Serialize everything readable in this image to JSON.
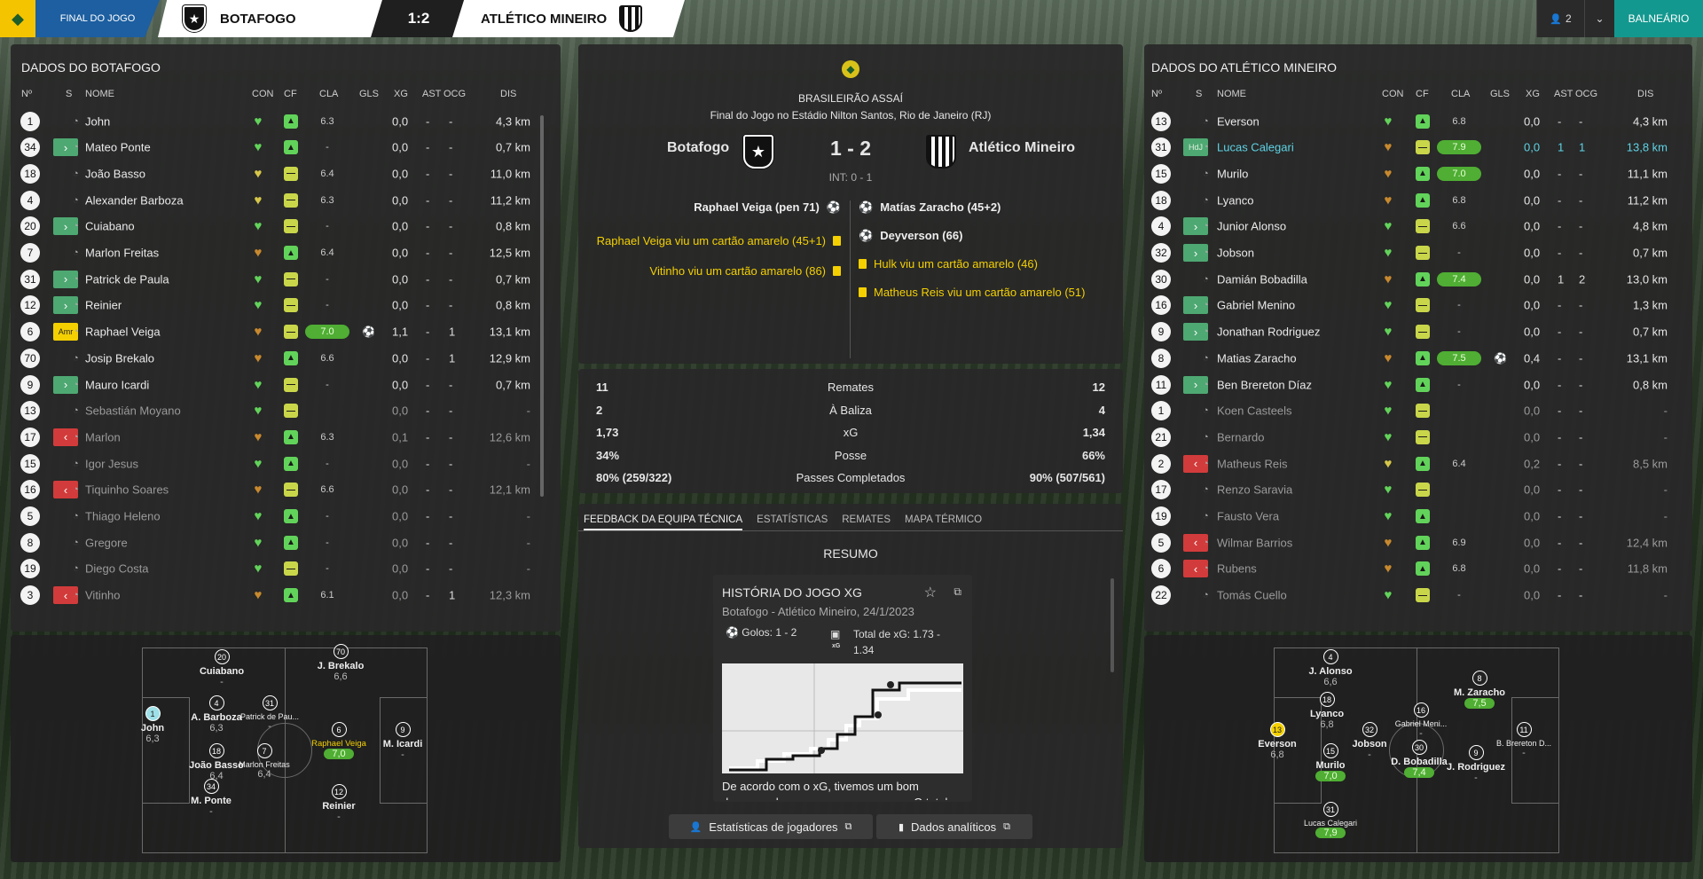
{
  "topbar": {
    "stage": "FINAL DO JOGO",
    "home": "BOTAFOGO",
    "score": "1:2",
    "away": "ATLÉTICO MINEIRO",
    "user_count": "2",
    "balneario": "BALNEÁRIO"
  },
  "home_panel": {
    "title": "DADOS DO BOTAFOGO"
  },
  "away_panel": {
    "title": "DADOS DO ATLÉTICO MINEIRO"
  },
  "columns": {
    "n": "Nº",
    "s": "S",
    "nome": "NOME",
    "con": "CON",
    "cf": "CF",
    "cla": "CLA",
    "gls": "GLS",
    "xg": "XG",
    "ast": "AST",
    "ocg": "OCG",
    "dis": "DIS"
  },
  "home_players": [
    {
      "n": "1",
      "s": "",
      "name": "John",
      "cf": "g",
      "heart": "g",
      "cla": "6.3",
      "hl": false,
      "gl": "",
      "xg": "0,0",
      "ast": "-",
      "ocg": "-",
      "dis": "4,3 km",
      "dim": false
    },
    {
      "n": "34",
      "s": "in",
      "name": "Mateo Ponte",
      "cf": "g",
      "heart": "g",
      "cla": "-",
      "hl": false,
      "gl": "",
      "xg": "0,0",
      "ast": "-",
      "ocg": "-",
      "dis": "0,7 km",
      "dim": false
    },
    {
      "n": "18",
      "s": "",
      "name": "João Basso",
      "cf": "y",
      "heart": "y",
      "cla": "6.4",
      "hl": false,
      "gl": "",
      "xg": "0,0",
      "ast": "-",
      "ocg": "-",
      "dis": "11,0 km",
      "dim": false
    },
    {
      "n": "4",
      "s": "",
      "name": "Alexander Barboza",
      "cf": "y",
      "heart": "y",
      "cla": "6.3",
      "hl": false,
      "gl": "",
      "xg": "0,0",
      "ast": "-",
      "ocg": "-",
      "dis": "11,2 km",
      "dim": false
    },
    {
      "n": "20",
      "s": "in",
      "name": "Cuiabano",
      "cf": "y",
      "heart": "g",
      "cla": "-",
      "hl": false,
      "gl": "",
      "xg": "0,0",
      "ast": "-",
      "ocg": "-",
      "dis": "0,8 km",
      "dim": false
    },
    {
      "n": "7",
      "s": "",
      "name": "Marlon Freitas",
      "cf": "g",
      "heart": "o",
      "cla": "6.4",
      "hl": false,
      "gl": "",
      "xg": "0,0",
      "ast": "-",
      "ocg": "-",
      "dis": "12,5 km",
      "dim": false
    },
    {
      "n": "31",
      "s": "in",
      "name": "Patrick de Paula",
      "cf": "y",
      "heart": "g",
      "cla": "-",
      "hl": false,
      "gl": "",
      "xg": "0,0",
      "ast": "-",
      "ocg": "-",
      "dis": "0,7 km",
      "dim": false
    },
    {
      "n": "12",
      "s": "in",
      "name": "Reinier",
      "cf": "y",
      "heart": "g",
      "cla": "-",
      "hl": false,
      "gl": "",
      "xg": "0,0",
      "ast": "-",
      "ocg": "-",
      "dis": "0,8 km",
      "dim": false
    },
    {
      "n": "6",
      "s": "amr",
      "name": "Raphael Veiga",
      "cf": "y",
      "heart": "o",
      "cla": "7.0",
      "hl": true,
      "gl": "⚽",
      "xg": "1,1",
      "ast": "-",
      "ocg": "1",
      "dis": "13,1 km",
      "dim": false
    },
    {
      "n": "70",
      "s": "",
      "name": "Josip Brekalo",
      "cf": "g",
      "heart": "o",
      "cla": "6.6",
      "hl": false,
      "gl": "",
      "xg": "0,0",
      "ast": "-",
      "ocg": "1",
      "dis": "12,9 km",
      "dim": false
    },
    {
      "n": "9",
      "s": "in",
      "name": "Mauro Icardi",
      "cf": "y",
      "heart": "g",
      "cla": "-",
      "hl": false,
      "gl": "",
      "xg": "0,0",
      "ast": "-",
      "ocg": "-",
      "dis": "0,7 km",
      "dim": false
    },
    {
      "n": "13",
      "s": "",
      "name": "Sebastián Moyano",
      "cf": "y",
      "heart": "g",
      "cla": "",
      "hl": false,
      "gl": "",
      "xg": "0,0",
      "ast": "-",
      "ocg": "-",
      "dis": "-",
      "dim": true
    },
    {
      "n": "17",
      "s": "out",
      "name": "Marlon",
      "cf": "g",
      "heart": "o",
      "cla": "6.3",
      "hl": false,
      "gl": "",
      "xg": "0,1",
      "ast": "-",
      "ocg": "-",
      "dis": "12,6 km",
      "dim": true
    },
    {
      "n": "15",
      "s": "",
      "name": "Igor Jesus",
      "cf": "g",
      "heart": "g",
      "cla": "-",
      "hl": false,
      "gl": "",
      "xg": "0,0",
      "ast": "-",
      "ocg": "-",
      "dis": "-",
      "dim": true
    },
    {
      "n": "16",
      "s": "out",
      "name": "Tiquinho Soares",
      "cf": "y",
      "heart": "o",
      "cla": "6.6",
      "hl": false,
      "gl": "",
      "xg": "0,0",
      "ast": "-",
      "ocg": "-",
      "dis": "12,1 km",
      "dim": true
    },
    {
      "n": "5",
      "s": "",
      "name": "Thiago Heleno",
      "cf": "g",
      "heart": "g",
      "cla": "-",
      "hl": false,
      "gl": "",
      "xg": "0,0",
      "ast": "-",
      "ocg": "-",
      "dis": "-",
      "dim": true
    },
    {
      "n": "8",
      "s": "",
      "name": "Gregore",
      "cf": "g",
      "heart": "g",
      "cla": "-",
      "hl": false,
      "gl": "",
      "xg": "0,0",
      "ast": "-",
      "ocg": "-",
      "dis": "-",
      "dim": true
    },
    {
      "n": "19",
      "s": "",
      "name": "Diego Costa",
      "cf": "y",
      "heart": "g",
      "cla": "-",
      "hl": false,
      "gl": "",
      "xg": "0,0",
      "ast": "-",
      "ocg": "-",
      "dis": "-",
      "dim": true
    },
    {
      "n": "3",
      "s": "out",
      "name": "Vitinho",
      "cf": "g",
      "heart": "o",
      "cla": "6.1",
      "hl": false,
      "gl": "",
      "xg": "0,0",
      "ast": "-",
      "ocg": "1",
      "dis": "12,3 km",
      "dim": true
    }
  ],
  "away_players": [
    {
      "n": "13",
      "s": "",
      "name": "Everson",
      "cf": "g",
      "heart": "g",
      "cla": "6.8",
      "hl": false,
      "gl": "",
      "xg": "0,0",
      "ast": "-",
      "ocg": "-",
      "dis": "4,3 km",
      "dim": false,
      "cyan": false
    },
    {
      "n": "31",
      "s": "hdj",
      "name": "Lucas Calegari",
      "cf": "y",
      "heart": "o",
      "cla": "7.9",
      "hl": true,
      "gl": "",
      "xg": "0,0",
      "ast": "1",
      "ocg": "1",
      "dis": "13,8 km",
      "dim": false,
      "cyan": true
    },
    {
      "n": "15",
      "s": "",
      "name": "Murilo",
      "cf": "g",
      "heart": "o",
      "cla": "7.0",
      "hl": true,
      "gl": "",
      "xg": "0,0",
      "ast": "-",
      "ocg": "-",
      "dis": "11,1 km",
      "dim": false,
      "cyan": false
    },
    {
      "n": "18",
      "s": "",
      "name": "Lyanco",
      "cf": "g",
      "heart": "o",
      "cla": "6.8",
      "hl": false,
      "gl": "",
      "xg": "0,0",
      "ast": "-",
      "ocg": "-",
      "dis": "11,2 km",
      "dim": false,
      "cyan": false
    },
    {
      "n": "4",
      "s": "in",
      "name": "Junior Alonso",
      "cf": "y",
      "heart": "g",
      "cla": "6.6",
      "hl": false,
      "gl": "",
      "xg": "0,0",
      "ast": "-",
      "ocg": "-",
      "dis": "4,8 km",
      "dim": false,
      "cyan": false
    },
    {
      "n": "32",
      "s": "in",
      "name": "Jobson",
      "cf": "y",
      "heart": "g",
      "cla": "-",
      "hl": false,
      "gl": "",
      "xg": "0,0",
      "ast": "-",
      "ocg": "-",
      "dis": "0,7 km",
      "dim": false,
      "cyan": false
    },
    {
      "n": "30",
      "s": "",
      "name": "Damián Bobadilla",
      "cf": "g",
      "heart": "o",
      "cla": "7.4",
      "hl": true,
      "gl": "",
      "xg": "0,0",
      "ast": "1",
      "ocg": "2",
      "dis": "13,0 km",
      "dim": false,
      "cyan": false
    },
    {
      "n": "16",
      "s": "in",
      "name": "Gabriel Menino",
      "cf": "y",
      "heart": "g",
      "cla": "-",
      "hl": false,
      "gl": "",
      "xg": "0,0",
      "ast": "-",
      "ocg": "-",
      "dis": "1,3 km",
      "dim": false,
      "cyan": false
    },
    {
      "n": "9",
      "s": "in",
      "name": "Jonathan Rodriguez",
      "cf": "y",
      "heart": "g",
      "cla": "-",
      "hl": false,
      "gl": "",
      "xg": "0,0",
      "ast": "-",
      "ocg": "-",
      "dis": "0,7 km",
      "dim": false,
      "cyan": false
    },
    {
      "n": "8",
      "s": "",
      "name": "Matias Zaracho",
      "cf": "g",
      "heart": "o",
      "cla": "7.5",
      "hl": true,
      "gl": "⚽",
      "xg": "0,4",
      "ast": "-",
      "ocg": "-",
      "dis": "13,1 km",
      "dim": false,
      "cyan": false
    },
    {
      "n": "11",
      "s": "in",
      "name": "Ben Brereton Díaz",
      "cf": "g",
      "heart": "g",
      "cla": "-",
      "hl": false,
      "gl": "",
      "xg": "0,0",
      "ast": "-",
      "ocg": "-",
      "dis": "0,8 km",
      "dim": false,
      "cyan": false
    },
    {
      "n": "1",
      "s": "",
      "name": "Koen Casteels",
      "cf": "y",
      "heart": "g",
      "cla": "",
      "hl": false,
      "gl": "",
      "xg": "0,0",
      "ast": "-",
      "ocg": "-",
      "dis": "-",
      "dim": true,
      "cyan": false
    },
    {
      "n": "21",
      "s": "",
      "name": "Bernardo",
      "cf": "y",
      "heart": "g",
      "cla": "",
      "hl": false,
      "gl": "",
      "xg": "0,0",
      "ast": "-",
      "ocg": "-",
      "dis": "-",
      "dim": true,
      "cyan": false
    },
    {
      "n": "2",
      "s": "out",
      "name": "Matheus Reis",
      "cf": "g",
      "heart": "y",
      "cla": "6.4",
      "hl": false,
      "gl": "",
      "xg": "0,2",
      "ast": "-",
      "ocg": "-",
      "dis": "8,5 km",
      "dim": true,
      "cyan": false
    },
    {
      "n": "17",
      "s": "",
      "name": "Renzo Saravia",
      "cf": "y",
      "heart": "g",
      "cla": "",
      "hl": false,
      "gl": "",
      "xg": "0,0",
      "ast": "-",
      "ocg": "-",
      "dis": "-",
      "dim": true,
      "cyan": false
    },
    {
      "n": "19",
      "s": "",
      "name": "Fausto Vera",
      "cf": "g",
      "heart": "g",
      "cla": "",
      "hl": false,
      "gl": "",
      "xg": "0,0",
      "ast": "-",
      "ocg": "-",
      "dis": "-",
      "dim": true,
      "cyan": false
    },
    {
      "n": "5",
      "s": "out",
      "name": "Wilmar Barrios",
      "cf": "g",
      "heart": "o",
      "cla": "6.9",
      "hl": false,
      "gl": "",
      "xg": "0,0",
      "ast": "-",
      "ocg": "-",
      "dis": "12,4 km",
      "dim": true,
      "cyan": false
    },
    {
      "n": "6",
      "s": "out",
      "name": "Rubens",
      "cf": "g",
      "heart": "o",
      "cla": "6.8",
      "hl": false,
      "gl": "",
      "xg": "0,0",
      "ast": "-",
      "ocg": "-",
      "dis": "11,8 km",
      "dim": true,
      "cyan": false
    },
    {
      "n": "22",
      "s": "",
      "name": "Tomás Cuello",
      "cf": "y",
      "heart": "g",
      "cla": "-",
      "hl": false,
      "gl": "",
      "xg": "0,0",
      "ast": "-",
      "ocg": "-",
      "dis": "-",
      "dim": true,
      "cyan": false
    }
  ],
  "home_pitch": [
    {
      "n": "1",
      "name": "John",
      "r": "6,3",
      "hl": false,
      "gk": true
    },
    {
      "n": "20",
      "name": "Cuiabano",
      "r": "-",
      "hl": false
    },
    {
      "n": "4",
      "name": "A. Barboza",
      "r": "6,3",
      "hl": false
    },
    {
      "n": "18",
      "name": "João Basso",
      "r": "6,4",
      "hl": false
    },
    {
      "n": "34",
      "name": "M. Ponte",
      "r": "-",
      "hl": false
    },
    {
      "n": "31",
      "name": "Patrick de Pau...",
      "r": "-",
      "hl": false
    },
    {
      "n": "7",
      "name": "Marlon Freitas",
      "r": "6,4",
      "hl": false
    },
    {
      "n": "70",
      "name": "J. Brekalo",
      "r": "6,6",
      "hl": false
    },
    {
      "n": "6",
      "name": "Raphael Veiga",
      "r": "7,0",
      "hl": true,
      "ylw_name": true
    },
    {
      "n": "12",
      "name": "Reinier",
      "r": "-",
      "hl": false
    },
    {
      "n": "9",
      "name": "M. Icardi",
      "r": "-",
      "hl": false
    }
  ],
  "away_pitch": [
    {
      "n": "13",
      "name": "Everson",
      "r": "6,8",
      "hl": false,
      "ylw": true
    },
    {
      "n": "4",
      "name": "J. Alonso",
      "r": "6,6",
      "hl": false
    },
    {
      "n": "18",
      "name": "Lyanco",
      "r": "6,8",
      "hl": false
    },
    {
      "n": "15",
      "name": "Murilo",
      "r": "7,0",
      "hl": true
    },
    {
      "n": "31",
      "name": "Lucas Calegari",
      "r": "7,9",
      "hl": true
    },
    {
      "n": "32",
      "name": "Jobson",
      "r": "-",
      "hl": false
    },
    {
      "n": "16",
      "name": "Gabriel Meni...",
      "r": "-",
      "hl": false
    },
    {
      "n": "30",
      "name": "D. Bobadilla",
      "r": "7,4",
      "hl": true
    },
    {
      "n": "8",
      "name": "M. Zaracho",
      "r": "7,5",
      "hl": true
    },
    {
      "n": "9",
      "name": "J. Rodriguez",
      "r": "-",
      "hl": false
    },
    {
      "n": "11",
      "name": "B. Brereton D...",
      "r": "-",
      "hl": false
    }
  ],
  "center": {
    "competition": "BRASILEIRÃO ASSAÍ",
    "venue": "Final do Jogo no Estádio Nilton Santos, Rio de Janeiro (RJ)",
    "home": "Botafogo",
    "away": "Atlético Mineiro",
    "score": "1 - 2",
    "ht": "INT: 0 - 1",
    "home_events": [
      "Raphael Veiga (pen 71)",
      "Raphael Veiga viu um cartão amarelo (45+1)",
      "Vitinho viu um cartão amarelo (86)"
    ],
    "away_events": [
      "Matías Zaracho (45+2)",
      "Deyverson (66)",
      "Hulk viu um cartão amarelo (46)",
      "Matheus Reis viu um cartão amarelo (51)"
    ],
    "stats": [
      {
        "h": "11",
        "label": "Remates",
        "a": "12"
      },
      {
        "h": "2",
        "label": "À Baliza",
        "a": "4"
      },
      {
        "h": "1,73",
        "label": "xG",
        "a": "1,34"
      },
      {
        "h": "34%",
        "label": "Posse",
        "a": "66%"
      },
      {
        "h": "80% (259/322)",
        "label": "Passes Completados",
        "a": "90% (507/561)"
      }
    ],
    "tabs": [
      "FEEDBACK DA EQUIPA TÉCNICA",
      "ESTATÍSTICAS",
      "REMATES",
      "MAPA TÉRMICO"
    ],
    "resumo": "RESUMO",
    "card_title": "HISTÓRIA DO JOGO XG",
    "card_sub": "Botafogo - Atlético Mineiro, 24/1/2023",
    "goals": "Golos: 1 - 2",
    "xg_total": "Total de xG: 1.73 - 1.34",
    "xg_label": "xG",
    "feedback": "De acordo com o xG, tivemos um bom desempenho, uma vez que o nosso xG total",
    "btn_players": "Estatísticas de jogadores",
    "btn_analytics": "Dados analíticos"
  },
  "colors": {
    "accent": "#13988f",
    "highlight": "#4fae33",
    "yellow": "#f4d000",
    "cyan": "#5fd3e6",
    "sub_in": "#4ea872",
    "sub_out": "#d23b3b"
  }
}
